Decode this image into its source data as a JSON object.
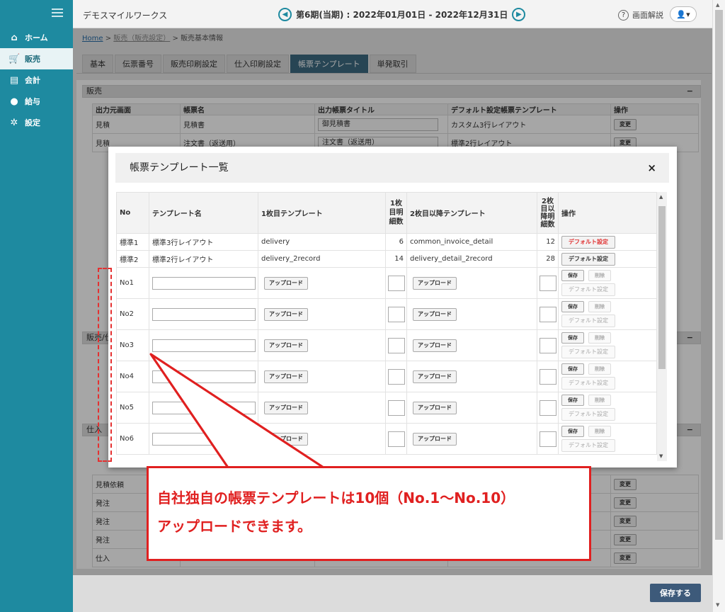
{
  "sidebar": {
    "items": [
      {
        "icon": "home-icon",
        "label": "ホーム"
      },
      {
        "icon": "cart-icon",
        "label": "販売"
      },
      {
        "icon": "ledger-icon",
        "label": "会計"
      },
      {
        "icon": "money-bag-icon",
        "label": "給与"
      },
      {
        "icon": "gear-icon",
        "label": "設定"
      }
    ]
  },
  "header": {
    "company": "デモスマイルワークス",
    "period": "第6期(当期) : 2022年01月01日 - 2022年12月31日",
    "help_label": "画面解説"
  },
  "breadcrumb": {
    "home": "Home",
    "sep": ">",
    "mid": "販売（販売設定）",
    "current": "販売基本情報"
  },
  "tabs": [
    "基本",
    "伝票番号",
    "販売印刷設定",
    "仕入印刷設定",
    "帳票テンプレート",
    "単発取引"
  ],
  "background": {
    "section1_title": "販売",
    "section2_title": "販売/仕入",
    "section3_title": "仕入",
    "collapse": "−",
    "headers": [
      "出力元画面",
      "帳票名",
      "出力帳票タイトル",
      "デフォルト設定帳票テンプレート",
      "操作"
    ],
    "rows": [
      {
        "screen": "見積",
        "name": "見積書",
        "title": "御見積書",
        "template": "カスタム3行レイアウト"
      },
      {
        "screen": "見積",
        "name": "注文書（返送用）",
        "title": "注文書（返送用）",
        "template": "標準2行レイアウト"
      }
    ],
    "lower_rows": [
      "見積依頼",
      "発注",
      "発注",
      "発注",
      "仕入"
    ],
    "change_label": "変更"
  },
  "modal": {
    "title": "帳票テンプレート一覧",
    "close": "×",
    "headers": {
      "no": "No",
      "name": "テンプレート名",
      "first": "1枚目テンプレート",
      "first_lines": "1枚目明細数",
      "second": "2枚目以降テンプレート",
      "second_lines": "2枚目以降明細数",
      "ops": "操作"
    },
    "std_rows": [
      {
        "no": "標準1",
        "name": "標準3行レイアウト",
        "first": "delivery",
        "first_lines": "6",
        "second": "common_invoice_detail",
        "second_lines": "12",
        "op": "デフォルト設定"
      },
      {
        "no": "標準2",
        "name": "標準2行レイアウト",
        "first": "delivery_2record",
        "first_lines": "14",
        "second": "delivery_detail_2record",
        "second_lines": "28",
        "op": "デフォルト設定"
      }
    ],
    "empty_rows": [
      "No1",
      "No2",
      "No3",
      "No4",
      "No5",
      "No6"
    ],
    "upload_label": "アップロード",
    "save_label": "保存",
    "delete_label": "削除",
    "default_label": "デフォルト設定"
  },
  "callout": {
    "line1": "自社独自の帳票テンプレートは10個（No.1〜No.10）",
    "line2": "アップロードできます。"
  },
  "footer": {
    "save": "保存する"
  }
}
